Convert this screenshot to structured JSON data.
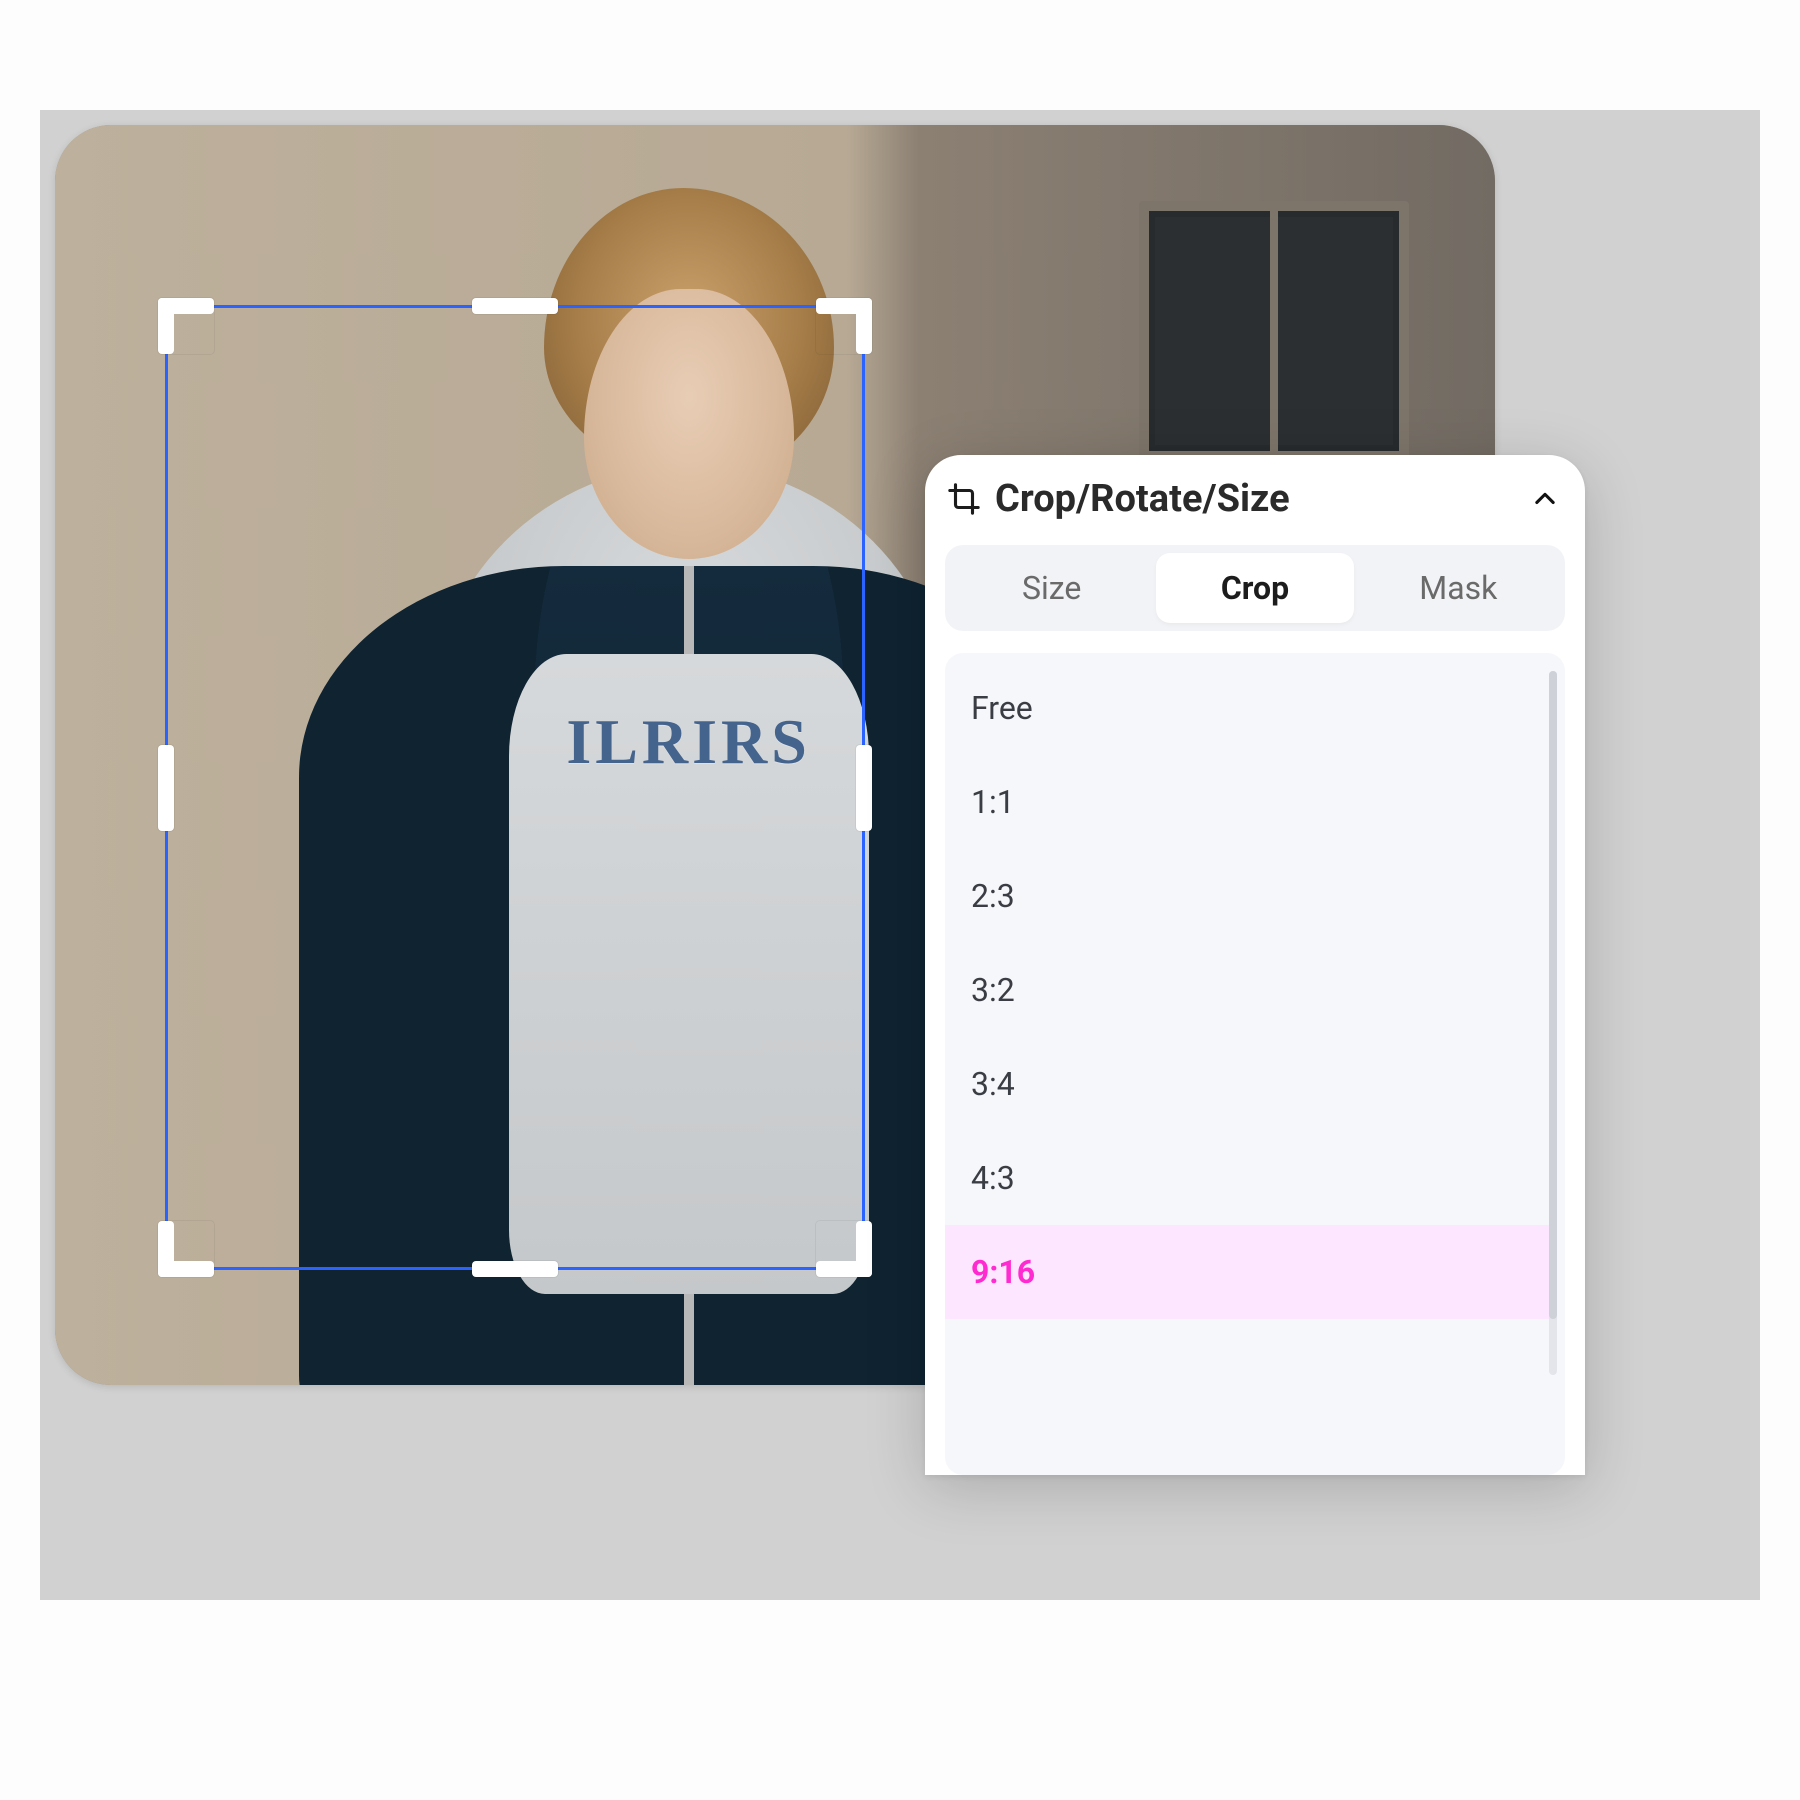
{
  "photo": {
    "print_text": "ILRIRS"
  },
  "panel": {
    "title": "Crop/Rotate/Size",
    "tabs": [
      {
        "label": "Size",
        "active": false
      },
      {
        "label": "Crop",
        "active": true
      },
      {
        "label": "Mask",
        "active": false
      }
    ],
    "options": [
      {
        "label": "Free",
        "selected": false
      },
      {
        "label": "1:1",
        "selected": false
      },
      {
        "label": "2:3",
        "selected": false
      },
      {
        "label": "3:2",
        "selected": false
      },
      {
        "label": "3:4",
        "selected": false
      },
      {
        "label": "4:3",
        "selected": false
      },
      {
        "label": "9:16",
        "selected": true
      }
    ],
    "colors": {
      "selected_bg": "#fde6ff",
      "selected_fg": "#ff2bd0",
      "crop_border": "#2a63ff"
    }
  }
}
